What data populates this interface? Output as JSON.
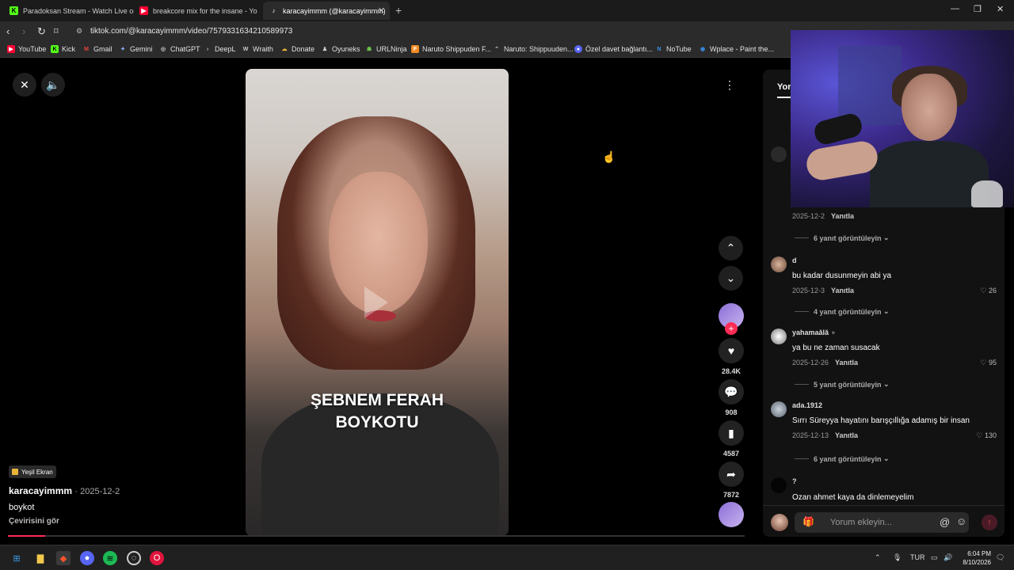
{
  "browser": {
    "tabs": [
      {
        "title": "Paradoksan Stream - Watch Live on K",
        "icon": "kick-icon",
        "color": "#53fc18",
        "active": false
      },
      {
        "title": "breakcore mix for the insane - Yo",
        "icon": "youtube-icon",
        "color": "#ff0033",
        "active": false
      },
      {
        "title": "karacayimmm (@karacayimmm)",
        "icon": "tiktok-icon",
        "color": "#ffffff",
        "active": true
      }
    ],
    "url": "tiktok.com/@karacayimmm/video/7579331634210589973",
    "bookmarks": [
      {
        "label": "YouTube",
        "icon": "youtube-icon",
        "color": "#ff0033"
      },
      {
        "label": "Kick",
        "icon": "kick-icon",
        "color": "#53fc18"
      },
      {
        "label": "Gmail",
        "icon": "gmail-icon",
        "color": "#ea4335"
      },
      {
        "label": "Gemini",
        "icon": "gemini-icon",
        "color": "#8ab4f8"
      },
      {
        "label": "ChatGPT",
        "icon": "chatgpt-icon",
        "color": "#cccccc"
      },
      {
        "label": "DeepL",
        "icon": "deepl-icon",
        "color": "#cccccc"
      },
      {
        "label": "Wraith",
        "icon": "wraith-icon",
        "color": "#cccccc"
      },
      {
        "label": "Donate",
        "icon": "donate-icon",
        "color": "#e8b339"
      },
      {
        "label": "Oyuneks",
        "icon": "oyuneks-icon",
        "color": "#cccccc"
      },
      {
        "label": "URLNinja",
        "icon": "urlninja-icon",
        "color": "#6cc04a"
      },
      {
        "label": "Naruto Shippuden F...",
        "icon": "naruto-icon",
        "color": "#f08a24"
      },
      {
        "label": "Naruto: Shippuuden...",
        "icon": "naruto2-icon",
        "color": "#cccccc"
      },
      {
        "label": "Özel davet bağlantı...",
        "icon": "discord-icon",
        "color": "#5865f2"
      },
      {
        "label": "NoTube",
        "icon": "notube-icon",
        "color": "#3a8ee6"
      },
      {
        "label": "Wplace - Paint the...",
        "icon": "wplace-icon",
        "color": "#3a8ee6"
      }
    ]
  },
  "video": {
    "caption_line1": "ŞEBNEM FERAH",
    "caption_line2": "BOYKOTU",
    "badge": "Yeşil Ekran",
    "author": "karacayimmm",
    "date": "· 2025-12-2",
    "description": "boykot",
    "see_translation": "Çevirisini gör",
    "progress_fraction": 0.05
  },
  "actions": {
    "likes": "28.4K",
    "comments": "908",
    "saves": "4587",
    "shares": "7872"
  },
  "comments_panel": {
    "tab_label": "Yor",
    "first_meta_date": "2025-12-2",
    "first_meta_reply": "Yanıtla",
    "first_view_replies": "6 yanıt görüntüleyin",
    "comments": [
      {
        "user": "d",
        "text": "bu kadar dusunmeyin abi ya",
        "date": "2025-12-3",
        "reply": "Yanıtla",
        "likes": "26",
        "view_replies": "4 yanıt görüntüleyin"
      },
      {
        "user": "yahamaălă ♆",
        "text": "ya bu ne zaman susacak",
        "date": "2025-12-26",
        "reply": "Yanıtla",
        "likes": "95",
        "view_replies": "5 yanıt görüntüleyin"
      },
      {
        "user": "ada.1912",
        "text": "Sırrı Süreyya hayatını barışçıllığa adamış bir insan",
        "date": "2025-12-13",
        "reply": "Yanıtla",
        "likes": "130",
        "view_replies": "6 yanıt görüntüleyin"
      },
      {
        "user": "?",
        "text": "Ozan ahmet kaya da dinlemeyelim",
        "date": "",
        "reply": "",
        "likes": "",
        "view_replies": ""
      }
    ],
    "input_placeholder": "Yorum ekleyin..."
  },
  "taskbar": {
    "language": "TUR",
    "time": "6:04 PM",
    "date": "8/10/2026"
  }
}
